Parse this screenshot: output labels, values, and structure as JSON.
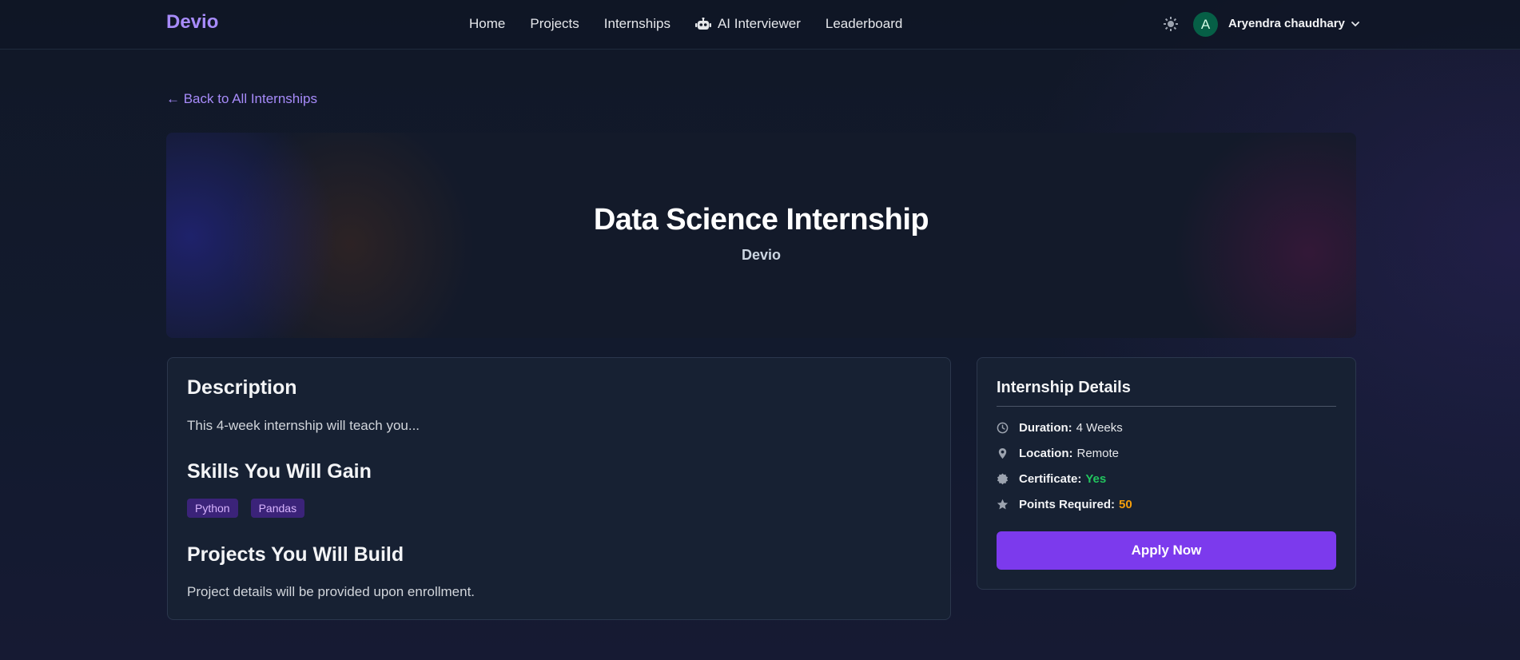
{
  "nav": {
    "brand": "Devio",
    "links": [
      {
        "label": "Home"
      },
      {
        "label": "Projects"
      },
      {
        "label": "Internships"
      },
      {
        "label": "AI Interviewer",
        "icon": "robot-icon"
      },
      {
        "label": "Leaderboard"
      }
    ],
    "theme_icon": "sun-icon",
    "user": {
      "avatar_letter": "A",
      "avatar_color": "#065f46",
      "name": "Aryendra chaudhary"
    }
  },
  "back_link": "← Back to All Internships",
  "hero": {
    "title": "Data Science Internship",
    "company": "Devio"
  },
  "main": {
    "description_heading": "Description",
    "description_text": "This 4-week internship will teach you...",
    "skills_heading": "Skills You Will Gain",
    "skills": [
      "Python",
      "Pandas"
    ],
    "projects_heading": "Projects You Will Build",
    "projects_text": "Project details will be provided upon enrollment."
  },
  "details": {
    "heading": "Internship Details",
    "items": [
      {
        "icon": "clock-icon",
        "label": "Duration:",
        "value": "4 Weeks",
        "value_color": "#e5e7eb"
      },
      {
        "icon": "location-pin-icon",
        "label": "Location:",
        "value": "Remote",
        "value_color": "#e5e7eb"
      },
      {
        "icon": "certificate-icon",
        "label": "Certificate:",
        "value": "Yes",
        "value_color": "#22c55e"
      },
      {
        "icon": "star-icon",
        "label": "Points Required:",
        "value": "50",
        "value_color": "#f59e0b"
      }
    ],
    "apply_label": "Apply Now"
  },
  "colors": {
    "accent": "#7c3aed",
    "brand": "#a78bfa",
    "chip_bg": "#3b2379"
  }
}
